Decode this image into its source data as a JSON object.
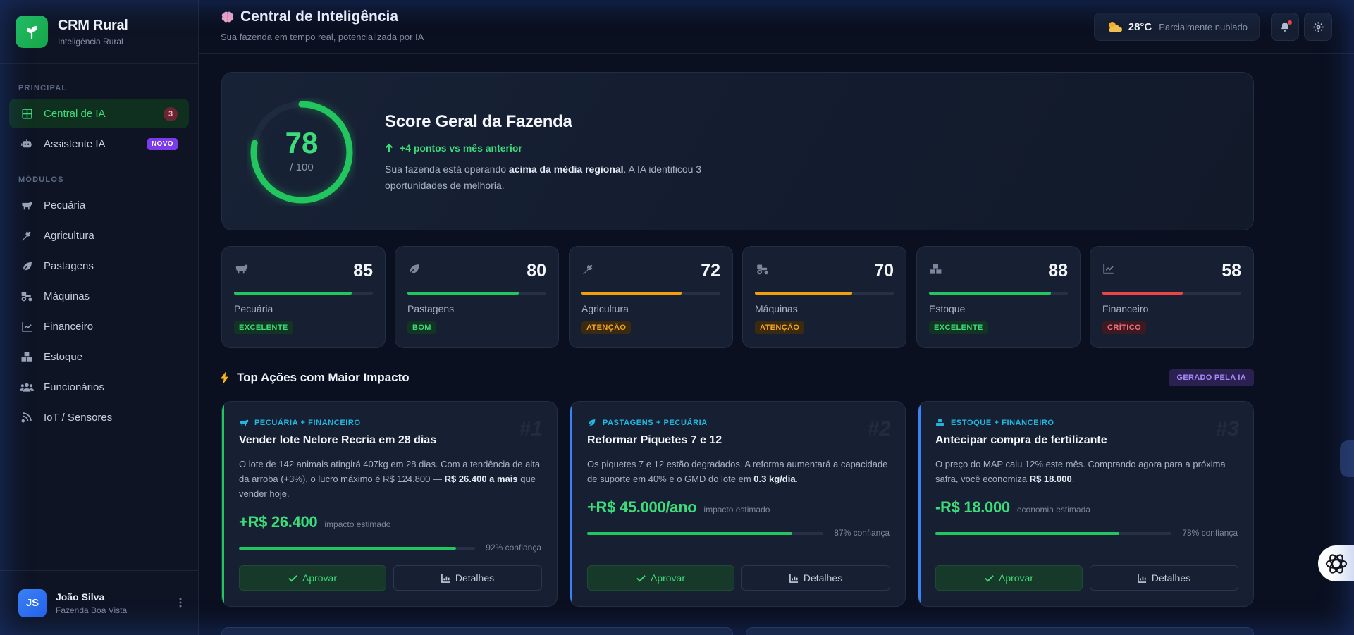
{
  "brand": {
    "title": "CRM Rural",
    "subtitle": "Inteligência Rural",
    "logo_icon": "sprout-icon"
  },
  "sidebar": {
    "section_principal": "PRINCIPAL",
    "section_modulos": "MÓDULOS",
    "principal_items": [
      {
        "label": "Central de IA",
        "icon": "grid-icon",
        "badge": "3",
        "active": true
      },
      {
        "label": "Assistente IA",
        "icon": "robot-icon",
        "tag": "NOVO"
      }
    ],
    "module_items": [
      {
        "label": "Pecuária",
        "icon": "cow-icon"
      },
      {
        "label": "Agricultura",
        "icon": "wheat-icon"
      },
      {
        "label": "Pastagens",
        "icon": "leaf-icon"
      },
      {
        "label": "Máquinas",
        "icon": "tractor-icon"
      },
      {
        "label": "Financeiro",
        "icon": "chart-line-icon"
      },
      {
        "label": "Estoque",
        "icon": "boxes-icon"
      },
      {
        "label": "Funcionários",
        "icon": "users-icon"
      },
      {
        "label": "IoT / Sensores",
        "icon": "satellite-icon"
      }
    ],
    "user": {
      "initials": "JS",
      "name": "João Silva",
      "farm": "Fazenda Boa Vista"
    }
  },
  "header": {
    "title": "Central de Inteligência",
    "title_icon": "brain-icon",
    "subtitle": "Sua fazenda em tempo real, potencializada por IA",
    "weather": {
      "temp": "28°C",
      "desc": "Parcialmente nublado",
      "icon": "sun-cloud-icon"
    }
  },
  "score": {
    "value": "78",
    "max": "/ 100",
    "fraction": 0.78,
    "title": "Score Geral da Fazenda",
    "delta": "+4 pontos vs mês anterior",
    "desc_pre": "Sua fazenda está operando ",
    "desc_bold": "acima da média regional",
    "desc_post": ". A IA identificou 3 oportunidades de melhoria."
  },
  "modules": [
    {
      "name": "Pecuária",
      "score": "85",
      "level": 0.85,
      "status": "EXCELENTE",
      "color": "#22c55e",
      "status_bg": "#123523",
      "status_color": "#3ddc7a",
      "icon": "cow-icon"
    },
    {
      "name": "Pastagens",
      "score": "80",
      "level": 0.8,
      "status": "BOM",
      "color": "#22c55e",
      "status_bg": "#123523",
      "status_color": "#3ddc7a",
      "icon": "leaf-icon"
    },
    {
      "name": "Agricultura",
      "score": "72",
      "level": 0.72,
      "status": "ATENÇÃO",
      "color": "#f59e0b",
      "status_bg": "#3a2a10",
      "status_color": "#f5a524",
      "icon": "wheat-icon"
    },
    {
      "name": "Máquinas",
      "score": "70",
      "level": 0.7,
      "status": "ATENÇÃO",
      "color": "#f59e0b",
      "status_bg": "#3a2a10",
      "status_color": "#f5a524",
      "icon": "tractor-icon"
    },
    {
      "name": "Estoque",
      "score": "88",
      "level": 0.88,
      "status": "EXCELENTE",
      "color": "#22c55e",
      "status_bg": "#123523",
      "status_color": "#3ddc7a",
      "icon": "boxes-icon"
    },
    {
      "name": "Financeiro",
      "score": "58",
      "level": 0.58,
      "status": "CRÍTICO",
      "color": "#ef4444",
      "status_bg": "#3d1a22",
      "status_color": "#f26d7d",
      "icon": "chart-line-icon"
    }
  ],
  "actions_section": {
    "title": "Top Ações com Maior Impacto",
    "icon": "lightning-icon",
    "tag": "GERADO PELA IA"
  },
  "actions": [
    {
      "rank": "#1",
      "category": "PECUÁRIA + FINANCEIRO",
      "cat_icon": "cow-icon",
      "accent": "#22c55e",
      "title": "Vender lote Nelore Recria em 28 dias",
      "desc_pre": "O lote de 142 animais atingirá 407kg em 28 dias. Com a tendência de alta da arroba (+3%), o lucro máximo é R$ 124.800 — ",
      "desc_bold": "R$ 26.400 a mais",
      "desc_post": " que vender hoje.",
      "impact": "+R$ 26.400",
      "impact_label": "impacto estimado",
      "confidence": 0.92,
      "confidence_label": "92% confiança",
      "approve": "Aprovar",
      "details": "Detalhes"
    },
    {
      "rank": "#2",
      "category": "PASTAGENS + PECUÁRIA",
      "cat_icon": "leaf-icon",
      "accent": "#3b82f6",
      "title": "Reformar Piquetes 7 e 12",
      "desc_pre": "Os piquetes 7 e 12 estão degradados. A reforma aumentará a capacidade de suporte em 40% e o GMD do lote em ",
      "desc_bold": "0.3 kg/dia",
      "desc_post": ".",
      "impact": "+R$ 45.000/ano",
      "impact_label": "impacto estimado",
      "confidence": 0.87,
      "confidence_label": "87% confiança",
      "approve": "Aprovar",
      "details": "Detalhes"
    },
    {
      "rank": "#3",
      "category": "ESTOQUE + FINANCEIRO",
      "cat_icon": "boxes-icon",
      "accent": "#3b82f6",
      "title": "Antecipar compra de fertilizante",
      "desc_pre": "O preço do MAP caiu 12% este mês. Comprando agora para a próxima safra, você economiza ",
      "desc_bold": "R$ 18.000",
      "desc_post": ".",
      "impact": "-R$ 18.000",
      "impact_label": "economia estimada",
      "confidence": 0.78,
      "confidence_label": "78% confiança",
      "approve": "Aprovar",
      "details": "Detalhes"
    }
  ]
}
